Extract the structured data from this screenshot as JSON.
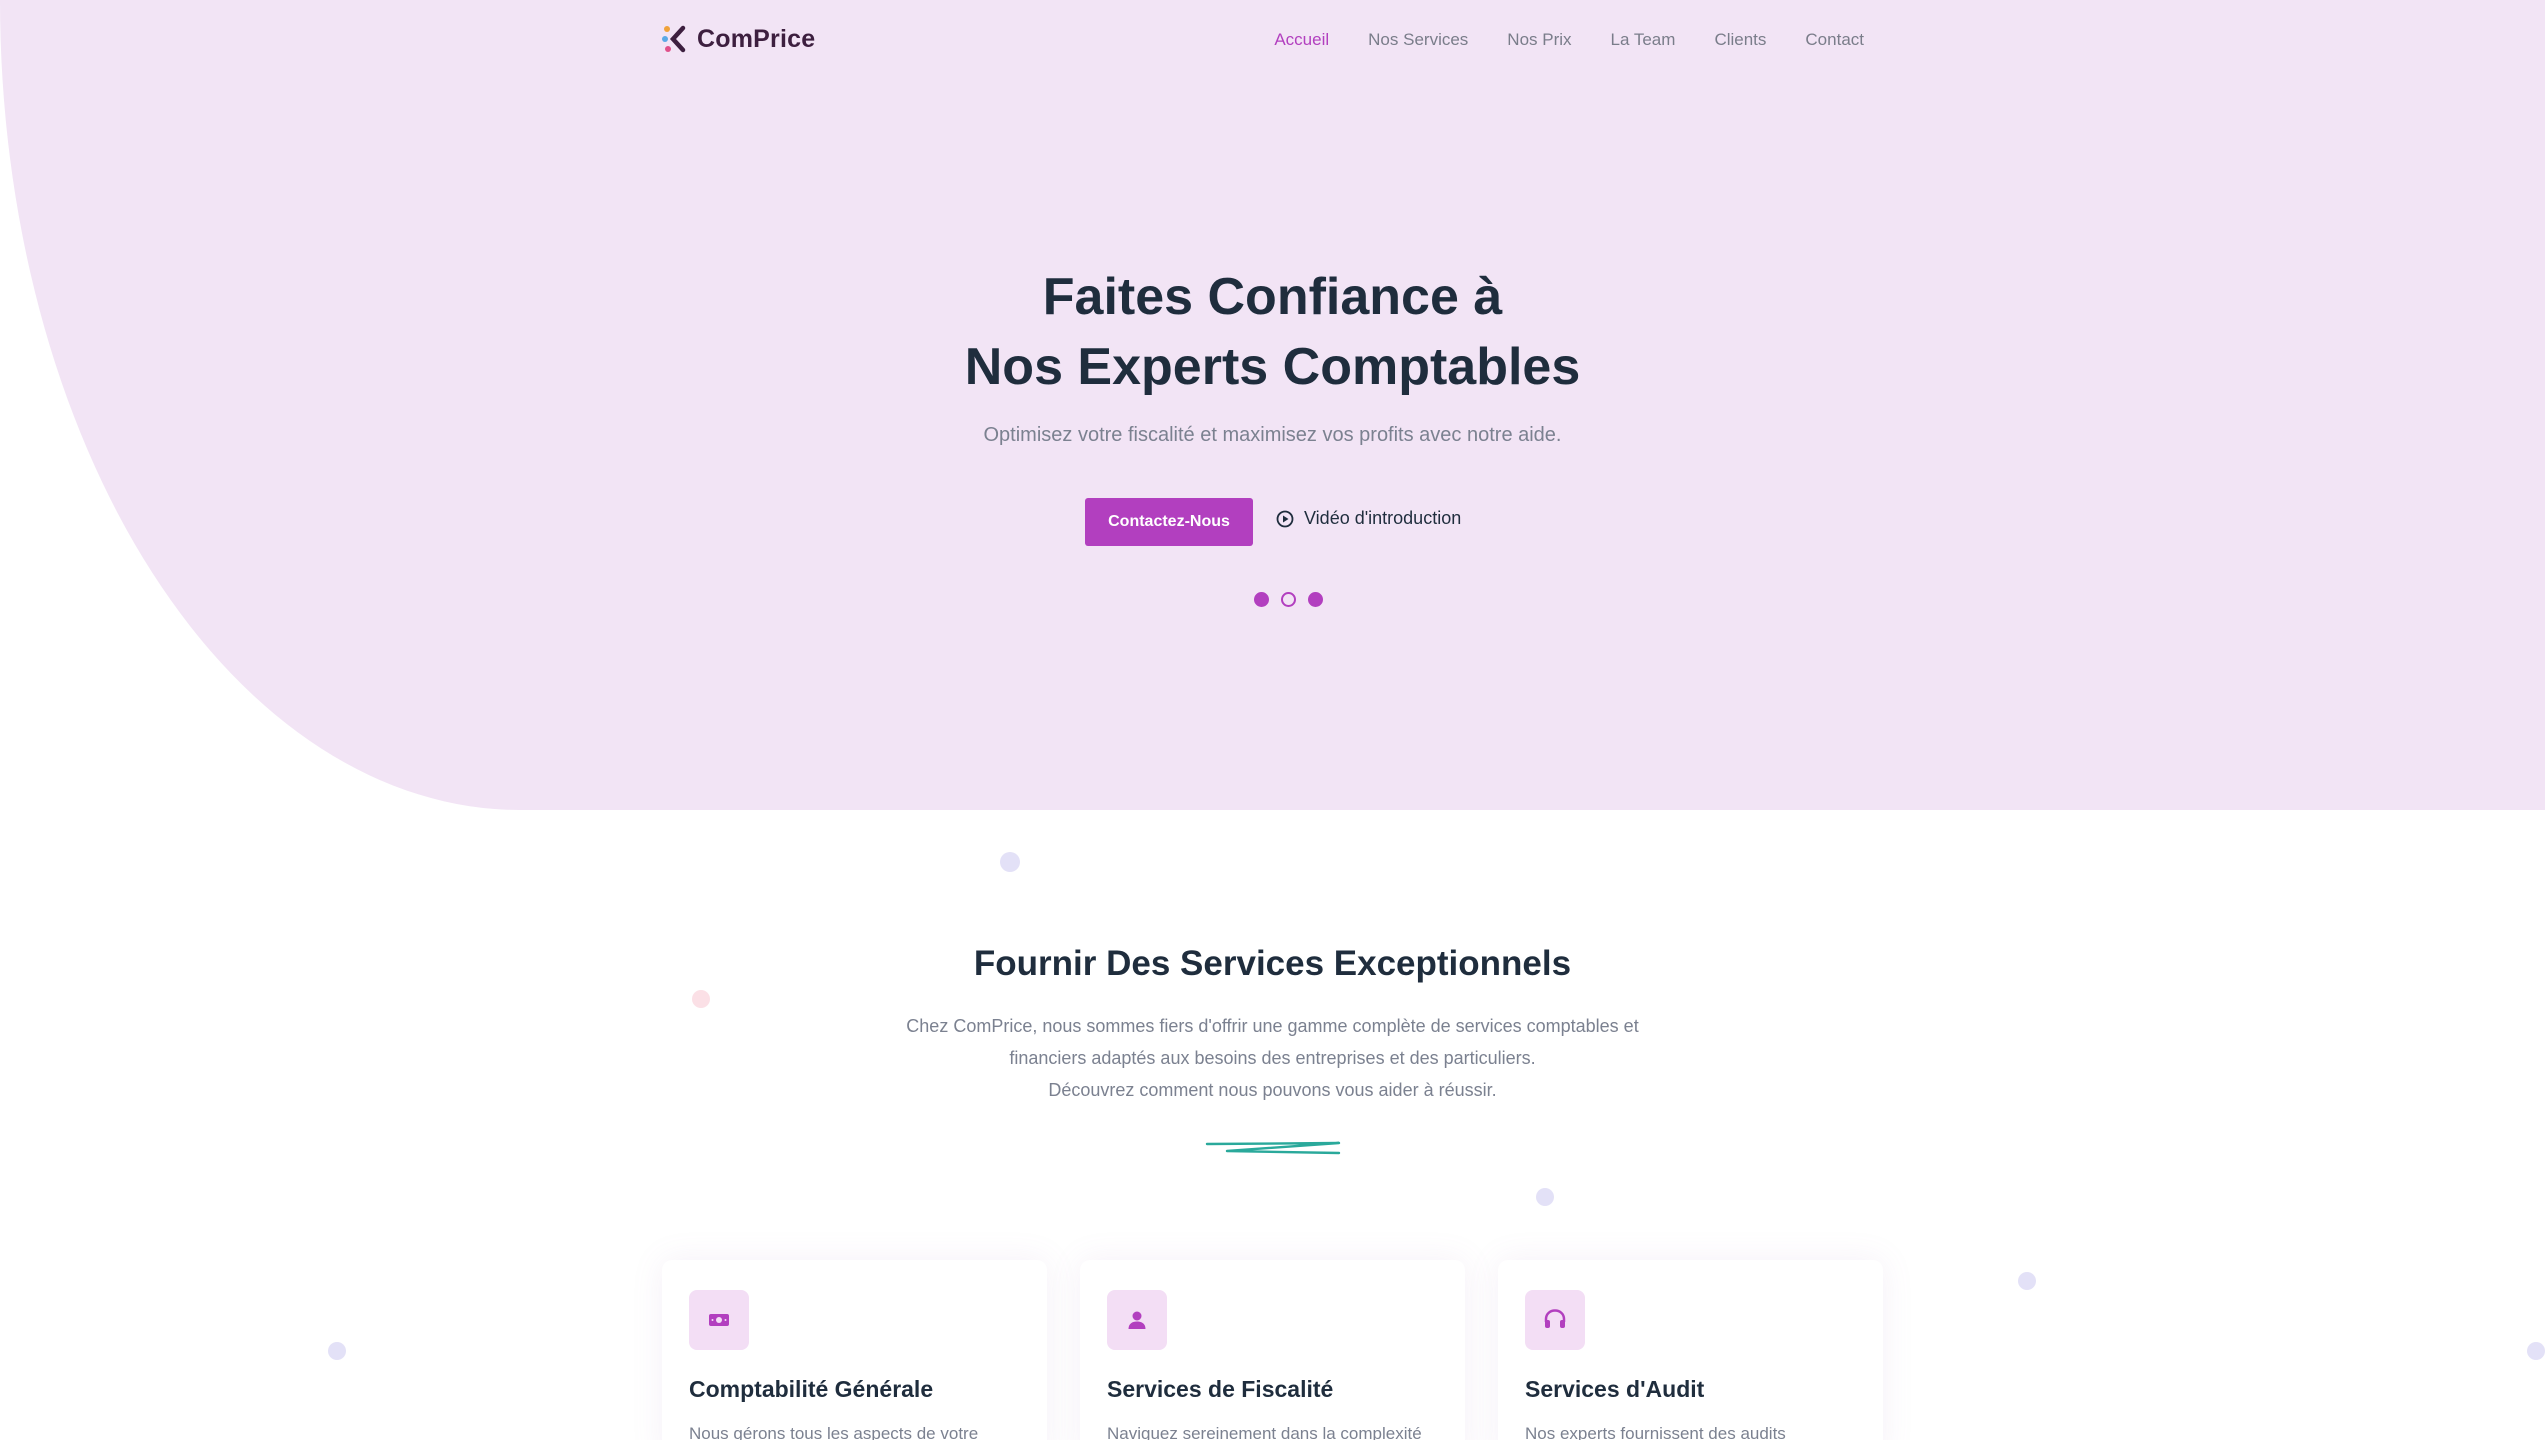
{
  "brand": {
    "name": "ComPrice"
  },
  "nav": {
    "items": [
      "Accueil",
      "Nos Services",
      "Nos Prix",
      "La Team",
      "Clients",
      "Contact"
    ],
    "active": "Accueil"
  },
  "hero": {
    "title_line1": "Faites Confiance à",
    "title_line2": "Nos Experts Comptables",
    "subtitle": "Optimisez votre fiscalité et maximisez vos profits avec notre aide.",
    "cta_label": "Contactez-Nous",
    "video_label": "Vidéo d'introduction",
    "slider_count": 3,
    "slider_active": 2
  },
  "services": {
    "title": "Fournir Des Services Exceptionnels",
    "description_lines": [
      "Chez ComPrice, nous sommes fiers d'offrir une gamme complète de services comptables et",
      "financiers adaptés aux besoins des entreprises et des particuliers.",
      "Découvrez comment nous pouvons vous aider à réussir."
    ],
    "cards": [
      {
        "title": "Comptabilité Générale",
        "text": "Nous gérons tous les aspects de votre",
        "icon": "money-icon"
      },
      {
        "title": "Services de Fiscalité",
        "text": "Naviguez sereinement dans la complexité",
        "icon": "user-icon"
      },
      {
        "title": "Services d'Audit",
        "text": "Nos experts fournissent des audits",
        "icon": "headset-icon"
      }
    ]
  },
  "colors": {
    "accent": "#b23fbf",
    "hero_bg": "#f2e4f5",
    "heading": "#1f2d3d",
    "muted": "#7b8190",
    "squiggle": "#2aa99b"
  }
}
